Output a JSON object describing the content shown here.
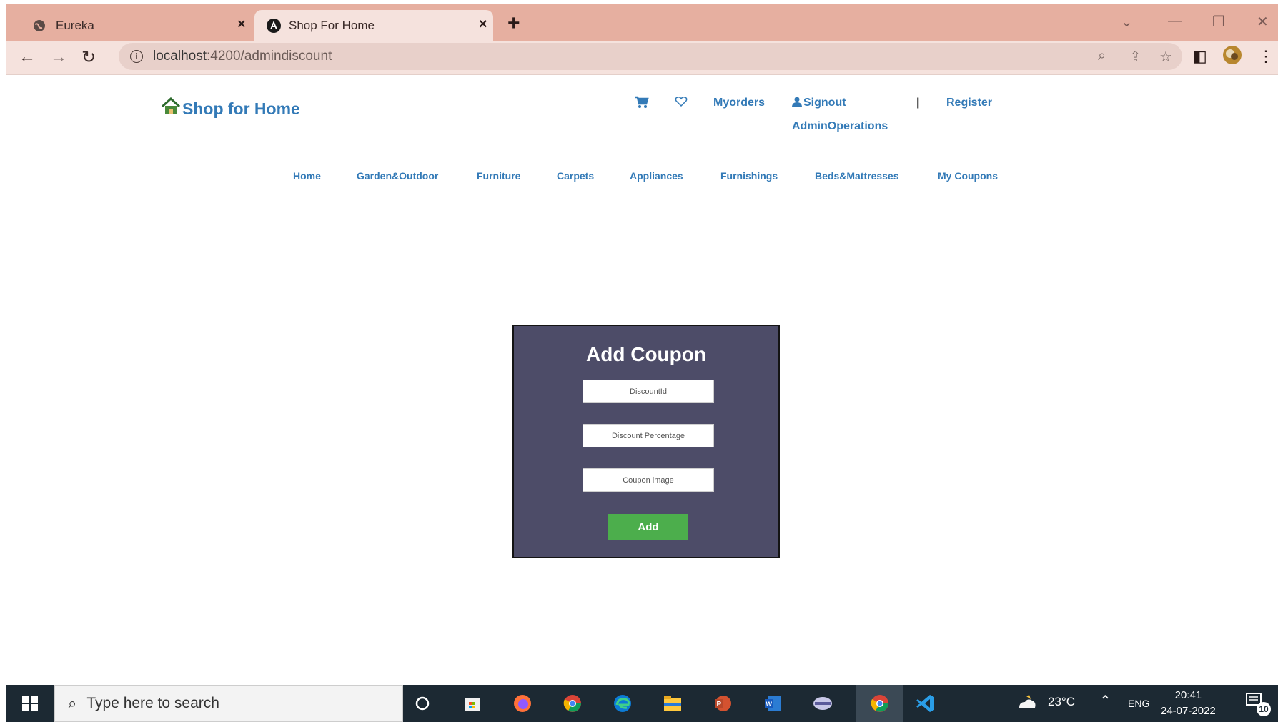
{
  "browser": {
    "tabs": [
      {
        "title": "Eureka",
        "close": "×"
      },
      {
        "title": "Shop For Home",
        "close": "×"
      }
    ],
    "new_tab": "+",
    "url_host": "localhost",
    "url_path": ":4200/admindiscount"
  },
  "header": {
    "brand": "Shop for Home",
    "myorders": "Myorders",
    "signout": "Signout",
    "admin_operations": "AdminOperations",
    "separator": "|",
    "register": "Register"
  },
  "nav": {
    "items": [
      "Home",
      "Garden&Outdoor",
      "Furniture",
      "Carpets",
      "Appliances",
      "Furnishings",
      "Beds&Mattresses",
      "My Coupons"
    ]
  },
  "coupon_form": {
    "title": "Add Coupon",
    "discount_id_placeholder": "DiscountId",
    "discount_percentage_placeholder": "Discount Percentage",
    "coupon_image_placeholder": "Coupon image",
    "add_label": "Add"
  },
  "taskbar": {
    "search_placeholder": "Type here to search",
    "temperature": "23°C",
    "language": "ENG",
    "time": "20:41",
    "date": "24-07-2022",
    "notification_count": "10"
  },
  "colors": {
    "link": "#337ab7",
    "card_bg": "#4d4c68",
    "add_button": "#4cae4c",
    "tab_strip": "#e6afa0"
  }
}
